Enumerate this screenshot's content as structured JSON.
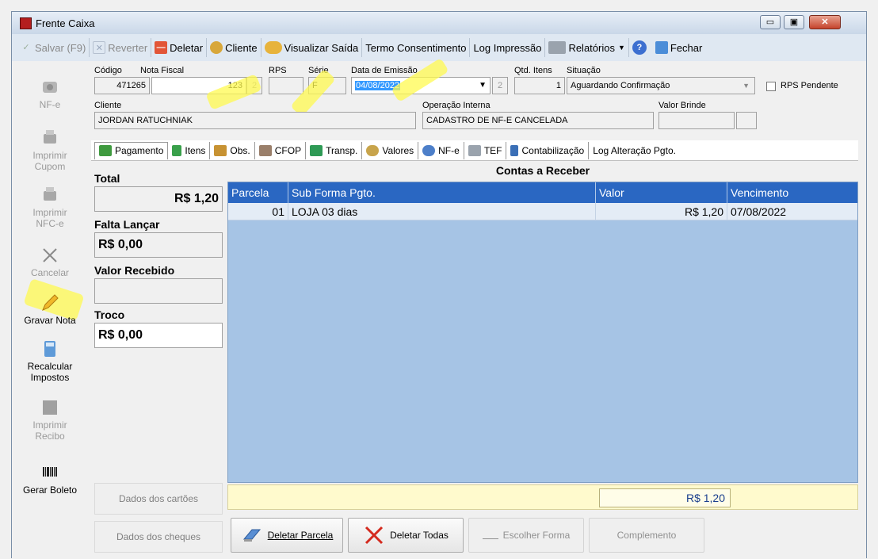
{
  "window": {
    "title": "Frente Caixa",
    "min_label": "▭",
    "max_label": "▣",
    "close_label": "✕"
  },
  "toolbar": {
    "salvar": "Salvar (F9)",
    "reverter": "Reverter",
    "deletar": "Deletar",
    "cliente": "Cliente",
    "visualizar_saida": "Visualizar Saída",
    "termo": "Termo Consentimento",
    "log_impressao": "Log Impressão",
    "relatorios": "Relatórios",
    "fechar": "Fechar"
  },
  "sidebar": {
    "nfe": "NF-e",
    "imprimir_cupom": "Imprimir\nCupom",
    "imprimir_nfce": "Imprimir\nNFC-e",
    "cancelar": "Cancelar",
    "gravar_nota": "Gravar Nota",
    "recalcular": "Recalcular\nImpostos",
    "imprimir_recibo": "Imprimir\nRecibo",
    "gerar_boleto": "Gerar Boleto"
  },
  "header": {
    "codigo_label": "Código",
    "codigo_value": "471265",
    "nota_label": "Nota Fiscal",
    "nota_value": "123",
    "rps_label": "RPS",
    "rps_value": "",
    "serie_label": "Série",
    "serie_value": "F",
    "data_label": "Data de Emissão",
    "data_value": "04/08/2022",
    "qtd_label": "Qtd. Itens",
    "qtd_value": "1",
    "situacao_label": "Situação",
    "situacao_value": "Aguardando Confirmação",
    "rps_pendente_label": "RPS Pendente",
    "cliente_label": "Cliente",
    "cliente_value": "JORDAN RATUCHNIAK",
    "operacao_label": "Operação Interna",
    "operacao_value": "CADASTRO DE NF-E CANCELADA",
    "brinde_label": "Valor Brinde",
    "brinde_value": ""
  },
  "tabs": {
    "pagamento": "Pagamento",
    "itens": "Itens",
    "obs": "Obs.",
    "cfop": "CFOP",
    "transp": "Transp.",
    "valores": "Valores",
    "nfe": "NF-e",
    "tef": "TEF",
    "contabilizacao": "Contabilização",
    "log": "Log Alteração Pgto."
  },
  "summary": {
    "total_label": "Total",
    "total_value": "R$ 1,20",
    "falta_label": "Falta Lançar",
    "falta_value": "R$ 0,00",
    "recebido_label": "Valor Recebido",
    "recebido_value": "",
    "troco_label": "Troco",
    "troco_value": "R$ 0,00"
  },
  "grid": {
    "title": "Contas a Receber",
    "columns": [
      "Parcela",
      "Sub Forma Pgto.",
      "Valor",
      "Vencimento"
    ],
    "rows": [
      {
        "parcela": "01",
        "forma": "LOJA 03 dias",
        "valor": "R$ 1,20",
        "vencimento": "07/08/2022"
      }
    ],
    "footer_total": "R$ 1,20"
  },
  "buttons": {
    "dados_cartoes": "Dados dos cartões",
    "dados_cheques": "Dados dos cheques",
    "deletar_parcela": "Deletar Parcela",
    "deletar_todas": "Deletar Todas",
    "escolher_forma": "Escolher Forma",
    "complemento": "Complemento"
  },
  "colors": {
    "grid_header": "#2a67c2",
    "grid_body": "#a6c4e5",
    "highlight": "#fffa50"
  }
}
